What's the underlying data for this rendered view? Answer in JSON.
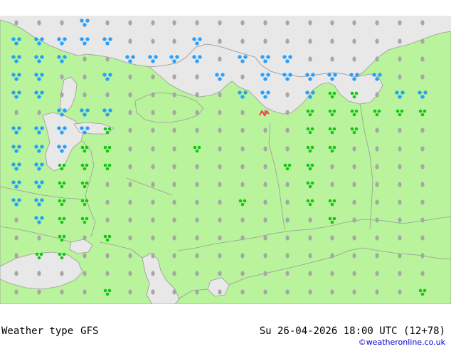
{
  "title": "Weather type",
  "model": "GFS",
  "valid_time": "Su 26-04-2026 18:00 UTC (12+78)",
  "credit": "©weatheronline.co.uk",
  "colors": {
    "land": "#b9f39c",
    "water": "#e8e8e8",
    "border": "#aaaaaa",
    "no_weather": "#a6a6a6",
    "snow": "#1a9bff",
    "rain": "#13c613",
    "thunder": "#ff3232"
  },
  "legend_note": "grey dot = no significant weather; blue = snow; green = rain/showers; red = thunder"
}
